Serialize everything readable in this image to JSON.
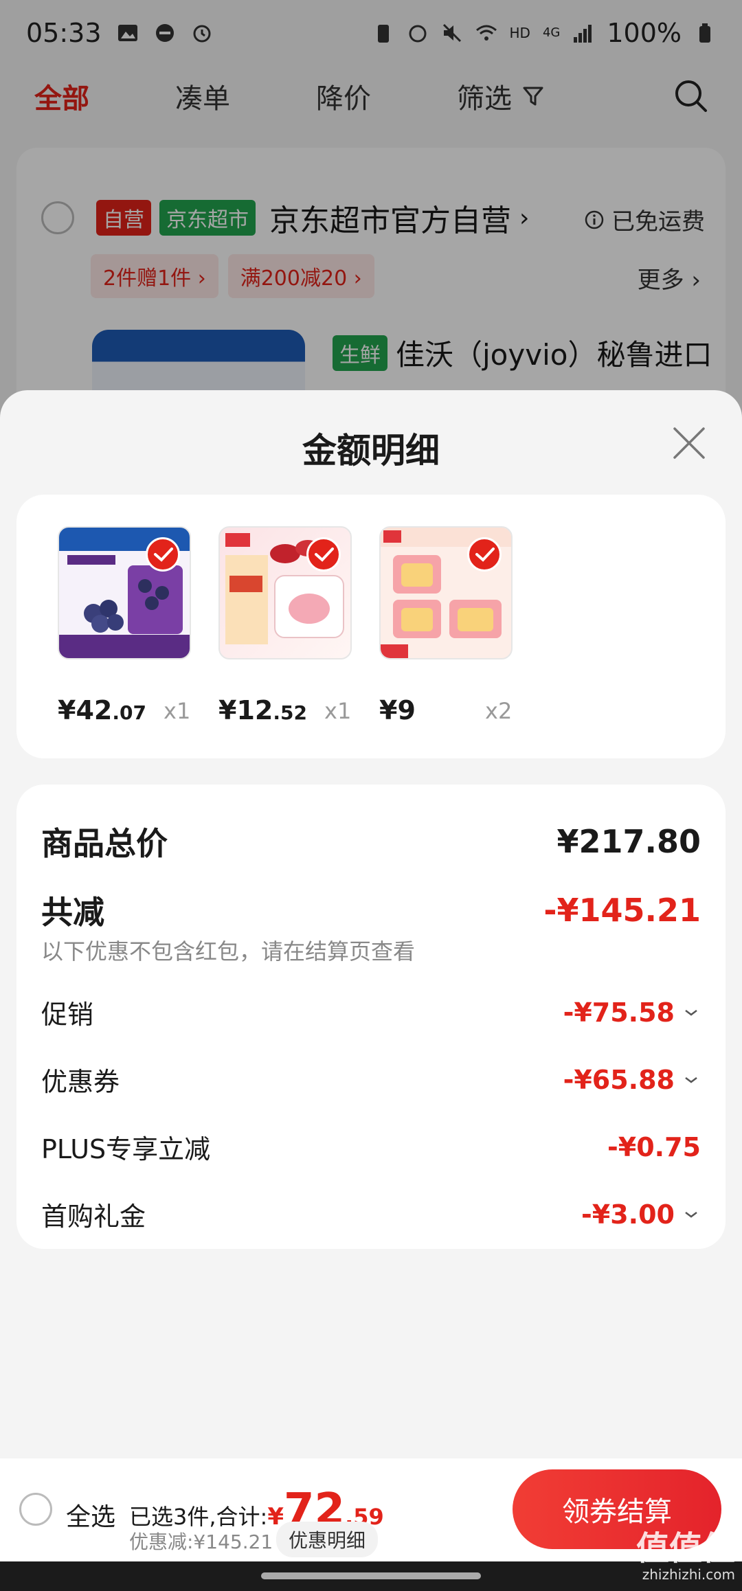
{
  "status_bar": {
    "time": "05:33",
    "network": "HD",
    "signal": "4G",
    "battery": "100%"
  },
  "nav": {
    "tabs": [
      "全部",
      "凑单",
      "降价",
      "筛选"
    ]
  },
  "shop": {
    "tag_self": "自营",
    "tag_market": "京东超市",
    "name": "京东超市官方自营",
    "free_shipping": "已免运费",
    "promos": [
      "2件赠1件 ›",
      "满200减20 ›"
    ],
    "more": "更多 ›",
    "item_tag": "生鲜",
    "item_title": "佳沃（joyvio）秘鲁进口"
  },
  "sheet": {
    "title": "金额明细",
    "products": [
      {
        "price_int": "¥42",
        "price_dec": ".07",
        "qty": "x1",
        "image": "blueberry-box"
      },
      {
        "price_int": "¥12",
        "price_dec": ".52",
        "qty": "x1",
        "image": "liby-laundry-pods"
      },
      {
        "price_int": "¥9",
        "price_dec": "",
        "qty": "x2",
        "image": "liby-fragrance-beads"
      }
    ],
    "total_label": "商品总价",
    "total_value": "¥217.80",
    "reduce_label": "共减",
    "reduce_value": "-¥145.21",
    "reduce_note": "以下优惠不包含红包，请在结算页查看",
    "items": [
      {
        "label": "促销",
        "value": "-¥75.58",
        "expandable": true
      },
      {
        "label": "优惠券",
        "value": "-¥65.88",
        "expandable": true
      },
      {
        "label": "PLUS专享立减",
        "value": "-¥0.75",
        "expandable": false
      },
      {
        "label": "首购礼金",
        "value": "-¥3.00",
        "expandable": true
      }
    ]
  },
  "bottom": {
    "select_all": "全选",
    "selected_text": "已选3件,合计:",
    "yen": "¥",
    "amount": "72",
    "amount_dec": ".59",
    "discount": "优惠减:¥145.21",
    "detail_button": "优惠明细",
    "checkout_button": "领券结算"
  },
  "watermark": {
    "text": "值值值",
    "sub": "zhizhizhi.com"
  },
  "colors": {
    "accent": "#e2231a",
    "green_tag": "#22a54f"
  }
}
